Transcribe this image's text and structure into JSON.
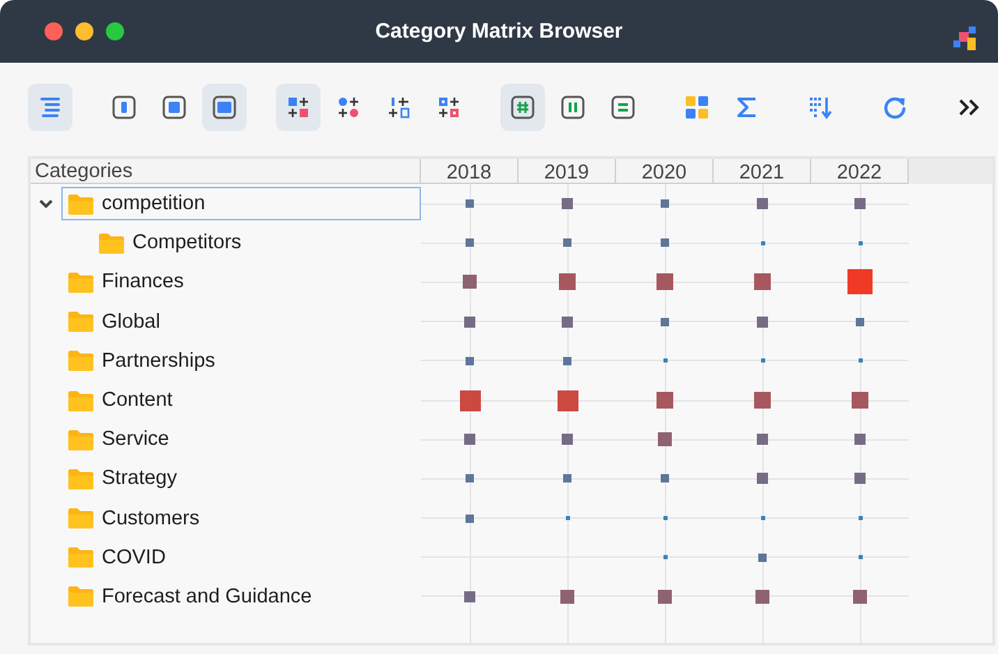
{
  "window": {
    "title": "Category Matrix Browser"
  },
  "toolbar": [
    [
      {
        "selected": true
      }
    ],
    [
      {
        "selected": false
      },
      {
        "selected": false
      },
      {
        "selected": true
      }
    ],
    [
      {
        "selected": true
      },
      {
        "selected": false
      },
      {
        "selected": false
      },
      {
        "selected": false
      }
    ],
    [
      {
        "selected": true
      },
      {
        "selected": false
      },
      {
        "selected": false
      }
    ],
    [
      {
        "selected": false
      },
      {
        "selected": false
      }
    ],
    [
      {
        "selected": false
      }
    ],
    [
      {
        "selected": false
      }
    ],
    [
      {
        "selected": false
      }
    ]
  ],
  "table": {
    "columns": [
      "Categories",
      "2018",
      "2019",
      "2020",
      "2021",
      "2022"
    ],
    "rows": [
      {
        "name": "competition",
        "selected": true,
        "expanded": true,
        "cells": [
          {
            "kind": "small"
          },
          {
            "kind": "medium"
          },
          {
            "kind": "small"
          },
          {
            "kind": "medium"
          },
          {
            "kind": "medium"
          }
        ],
        "children": [
          {
            "name": "Competitors",
            "selected": false,
            "cells": [
              {
                "kind": "small"
              },
              {
                "kind": "small"
              },
              {
                "kind": "small"
              },
              {
                "kind": "tiny"
              },
              {
                "kind": "tiny"
              }
            ]
          }
        ]
      },
      {
        "name": "Finances",
        "selected": false,
        "cells": [
          {
            "kind": "large"
          },
          {
            "kind": "larger"
          },
          {
            "kind": "larger"
          },
          {
            "kind": "larger"
          },
          {
            "kind": "max"
          }
        ]
      },
      {
        "name": "Global",
        "selected": false,
        "cells": [
          {
            "kind": "medium"
          },
          {
            "kind": "medium"
          },
          {
            "kind": "small"
          },
          {
            "kind": "medium"
          },
          {
            "kind": "small"
          }
        ]
      },
      {
        "name": "Partnerships",
        "selected": false,
        "cells": [
          {
            "kind": "small"
          },
          {
            "kind": "small"
          },
          {
            "kind": "tiny"
          },
          {
            "kind": "tiny"
          },
          {
            "kind": "tiny"
          }
        ]
      },
      {
        "name": "Content",
        "selected": false,
        "cells": [
          {
            "kind": "huge"
          },
          {
            "kind": "huge"
          },
          {
            "kind": "larger"
          },
          {
            "kind": "larger"
          },
          {
            "kind": "larger"
          }
        ]
      },
      {
        "name": "Service",
        "selected": false,
        "cells": [
          {
            "kind": "medium"
          },
          {
            "kind": "medium"
          },
          {
            "kind": "large"
          },
          {
            "kind": "medium"
          },
          {
            "kind": "medium"
          }
        ]
      },
      {
        "name": "Strategy",
        "selected": false,
        "cells": [
          {
            "kind": "small"
          },
          {
            "kind": "small"
          },
          {
            "kind": "small"
          },
          {
            "kind": "medium"
          },
          {
            "kind": "medium"
          }
        ]
      },
      {
        "name": "Customers",
        "selected": false,
        "cells": [
          {
            "kind": "small"
          },
          {
            "kind": "tiny"
          },
          {
            "kind": "tiny"
          },
          {
            "kind": "tiny"
          },
          {
            "kind": "tiny"
          }
        ]
      },
      {
        "name": "COVID",
        "selected": false,
        "cells": [
          null,
          null,
          {
            "kind": "tiny"
          },
          {
            "kind": "small"
          },
          {
            "kind": "tiny"
          }
        ]
      },
      {
        "name": "Forecast and Guidance",
        "selected": false,
        "cells": [
          {
            "kind": "medium"
          },
          {
            "kind": "large"
          },
          {
            "kind": "large"
          },
          {
            "kind": "large"
          },
          {
            "kind": "large"
          }
        ]
      }
    ]
  }
}
